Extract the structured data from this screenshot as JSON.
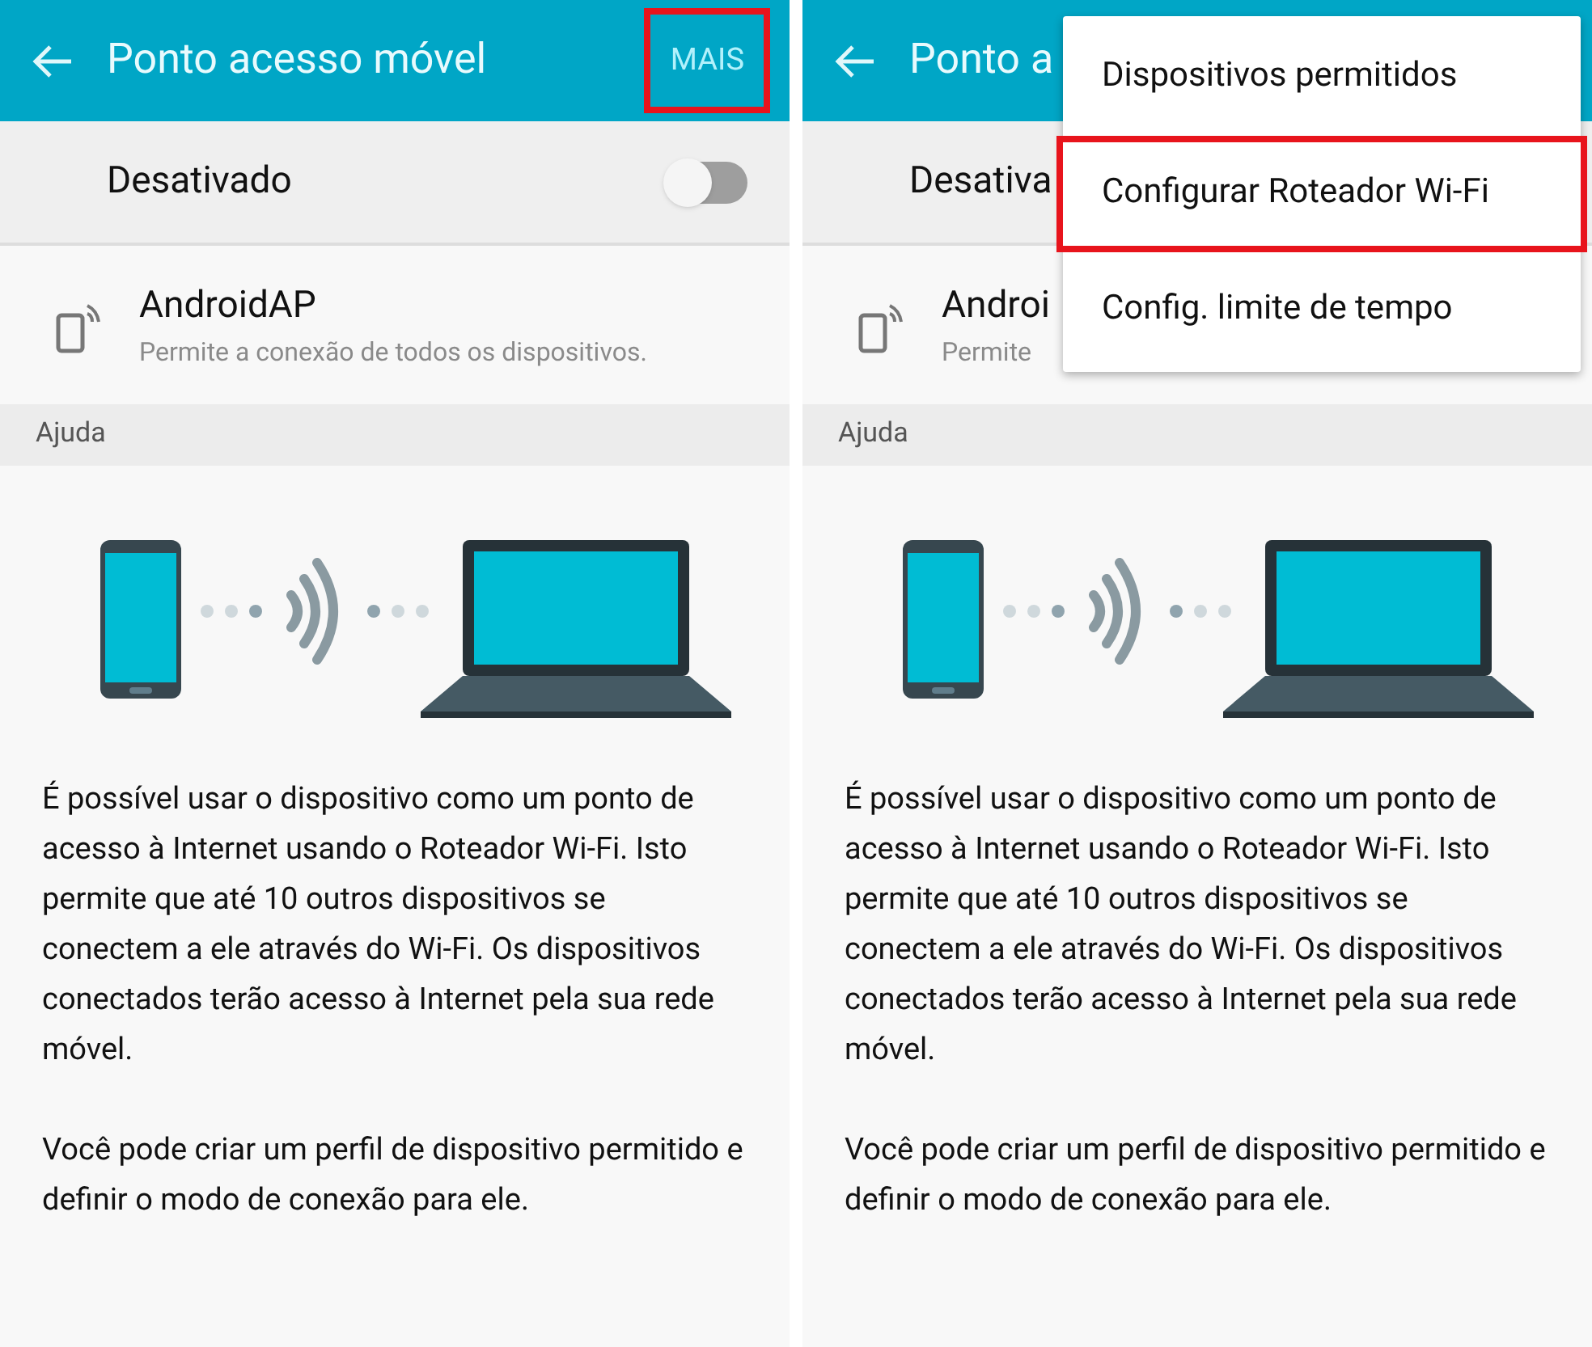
{
  "panels": [
    {
      "app_bar": {
        "title": "Ponto acesso móvel",
        "action": {
          "label": "MAIS",
          "highlighted": true
        }
      },
      "hotspot_switch": {
        "label": "Desativado",
        "on": false
      },
      "network": {
        "name": "AndroidAP",
        "description": "Permite a conexão de todos os dispositivos."
      },
      "section_header": "Ajuda",
      "paragraphs": [
        "É possível usar o dispositivo como um ponto de acesso à Internet usando o Roteador Wi-Fi. Isto permite que até 10 outros dispositivos se conectem a ele através do Wi-Fi. Os dispositivos conectados terão acesso à Internet pela sua rede móvel.",
        "Você pode criar um perfil de dispositivo permitido e definir o modo de conexão para ele."
      ]
    },
    {
      "app_bar": {
        "title": "Ponto a"
      },
      "hotspot_switch": {
        "label": "Desativa"
      },
      "network": {
        "name": "Androi",
        "description": "Permite"
      },
      "section_header": "Ajuda",
      "paragraphs": [
        "É possível usar o dispositivo como um ponto de acesso à Internet usando o Roteador Wi-Fi. Isto permite que até 10 outros dispositivos se conectem a ele através do Wi-Fi. Os dispositivos conectados terão acesso à Internet pela sua rede móvel.",
        "Você pode criar um perfil de dispositivo permitido e definir o modo de conexão para ele."
      ],
      "menu": {
        "items": [
          {
            "label": "Dispositivos permitidos",
            "highlighted": false
          },
          {
            "label": "Configurar Roteador Wi-Fi",
            "highlighted": true
          },
          {
            "label": "Config. limite de tempo",
            "highlighted": false
          }
        ]
      }
    }
  ]
}
